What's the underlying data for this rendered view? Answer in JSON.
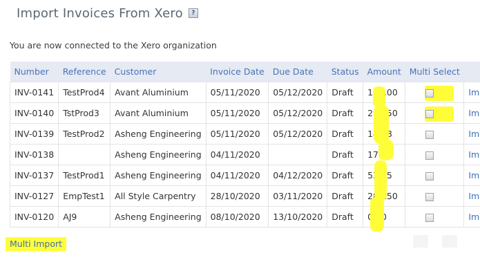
{
  "header": {
    "title": "Import Invoices From Xero",
    "help_icon": "?"
  },
  "connected_message": "You are now connected to the Xero organization",
  "table": {
    "columns": [
      "Number",
      "Reference",
      "Customer",
      "Invoice Date",
      "Due Date",
      "Status",
      "Amount",
      "Multi Select",
      ""
    ],
    "rows": [
      {
        "number": "INV-0141",
        "reference": "TestProd4",
        "customer": "Avant Aluminium",
        "invoice_date": "05/11/2020",
        "due_date": "05/12/2020",
        "status": "Draft",
        "amount": "115.00",
        "action": "Import"
      },
      {
        "number": "INV-0140",
        "reference": "TstProd3",
        "customer": "Avant Aluminium",
        "invoice_date": "05/11/2020",
        "due_date": "05/12/2020",
        "status": "Draft",
        "amount": "287.50",
        "action": "Import"
      },
      {
        "number": "INV-0139",
        "reference": "TestProd2",
        "customer": "Asheng Engineering",
        "invoice_date": "05/11/2020",
        "due_date": "05/12/2020",
        "status": "Draft",
        "amount": "14.38",
        "action": "Import"
      },
      {
        "number": "INV-0138",
        "reference": "",
        "customer": "Asheng Engineering",
        "invoice_date": "04/11/2020",
        "due_date": "",
        "status": "Draft",
        "amount": "17.25",
        "action": "Import"
      },
      {
        "number": "INV-0137",
        "reference": "TestProd1",
        "customer": "Asheng Engineering",
        "invoice_date": "04/11/2020",
        "due_date": "04/12/2020",
        "status": "Draft",
        "amount": "53.25",
        "action": "Import"
      },
      {
        "number": "INV-0127",
        "reference": "EmpTest1",
        "customer": "All Style Carpentry",
        "invoice_date": "28/10/2020",
        "due_date": "03/11/2020",
        "status": "Draft",
        "amount": "287.50",
        "action": "Import"
      },
      {
        "number": "INV-0120",
        "reference": "AJ9",
        "customer": "Asheng Engineering",
        "invoice_date": "08/10/2020",
        "due_date": "13/10/2020",
        "status": "Draft",
        "amount": "0.00",
        "action": "Import"
      }
    ]
  },
  "multi_import_label": "Multi Import",
  "colors": {
    "header_bg": "#e5eaf3",
    "link": "#3f6fb5",
    "highlight": "#fffd38"
  }
}
